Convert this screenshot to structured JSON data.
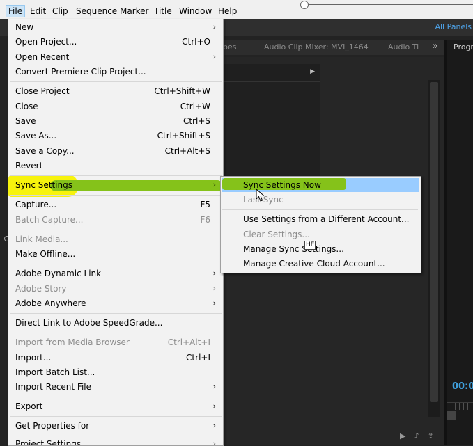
{
  "menubar": {
    "items": [
      "File",
      "Edit",
      "Clip",
      "Sequence",
      "Marker",
      "Title",
      "Window",
      "Help"
    ]
  },
  "background": {
    "all_panels": "All Panels",
    "tabs": [
      "pes",
      "Audio Clip Mixer: MVI_1464",
      "Audio Ti",
      "»"
    ],
    "program_tab": "Progr",
    "timecode": "00:0"
  },
  "file_menu": {
    "items": [
      {
        "label": "New",
        "shortcut": "",
        "submenu": true,
        "disabled": false
      },
      {
        "label": "Open Project...",
        "shortcut": "Ctrl+O",
        "submenu": false,
        "disabled": false
      },
      {
        "label": "Open Recent",
        "shortcut": "",
        "submenu": true,
        "disabled": false
      },
      {
        "label": "Convert Premiere Clip Project...",
        "shortcut": "",
        "submenu": false,
        "disabled": false
      },
      {
        "label": "Close Project",
        "shortcut": "Ctrl+Shift+W",
        "submenu": false,
        "disabled": false
      },
      {
        "label": "Close",
        "shortcut": "Ctrl+W",
        "submenu": false,
        "disabled": false
      },
      {
        "label": "Save",
        "shortcut": "Ctrl+S",
        "submenu": false,
        "disabled": false
      },
      {
        "label": "Save As...",
        "shortcut": "Ctrl+Shift+S",
        "submenu": false,
        "disabled": false
      },
      {
        "label": "Save a Copy...",
        "shortcut": "Ctrl+Alt+S",
        "submenu": false,
        "disabled": false
      },
      {
        "label": "Revert",
        "shortcut": "",
        "submenu": false,
        "disabled": false
      },
      {
        "label": "Sync Settings",
        "shortcut": "",
        "submenu": true,
        "disabled": false
      },
      {
        "label": "Capture...",
        "shortcut": "F5",
        "submenu": false,
        "disabled": false
      },
      {
        "label": "Batch Capture...",
        "shortcut": "F6",
        "submenu": false,
        "disabled": true
      },
      {
        "label": "Link Media...",
        "shortcut": "",
        "submenu": false,
        "disabled": true
      },
      {
        "label": "Make Offline...",
        "shortcut": "",
        "submenu": false,
        "disabled": false
      },
      {
        "label": "Adobe Dynamic Link",
        "shortcut": "",
        "submenu": true,
        "disabled": false
      },
      {
        "label": "Adobe Story",
        "shortcut": "",
        "submenu": true,
        "disabled": true
      },
      {
        "label": "Adobe Anywhere",
        "shortcut": "",
        "submenu": true,
        "disabled": false
      },
      {
        "label": "Direct Link to Adobe SpeedGrade...",
        "shortcut": "",
        "submenu": false,
        "disabled": false
      },
      {
        "label": "Import from Media Browser",
        "shortcut": "Ctrl+Alt+I",
        "submenu": false,
        "disabled": true
      },
      {
        "label": "Import...",
        "shortcut": "Ctrl+I",
        "submenu": false,
        "disabled": false
      },
      {
        "label": "Import Batch List...",
        "shortcut": "",
        "submenu": false,
        "disabled": false
      },
      {
        "label": "Import Recent File",
        "shortcut": "",
        "submenu": true,
        "disabled": false
      },
      {
        "label": "Export",
        "shortcut": "",
        "submenu": true,
        "disabled": false
      },
      {
        "label": "Get Properties for",
        "shortcut": "",
        "submenu": true,
        "disabled": false
      },
      {
        "label": "Project Settings",
        "shortcut": "",
        "submenu": true,
        "disabled": false
      }
    ]
  },
  "sync_submenu": {
    "items": [
      {
        "label": "Sync Settings Now",
        "disabled": false
      },
      {
        "label": "Last Sync",
        "disabled": true
      },
      {
        "label": "Use Settings from a Different Account...",
        "disabled": false
      },
      {
        "label": "Clear Settings...",
        "disabled": true
      },
      {
        "label": "Manage Sync Settings...",
        "disabled": false
      },
      {
        "label": "Manage Creative Cloud Account...",
        "disabled": false
      }
    ],
    "tooltip": "HE"
  },
  "colors": {
    "yellow_highlight": "#f7f200",
    "green_highlight": "#85c21a",
    "blue_hover": "#99ccff",
    "accent_blue": "#3f9fdb"
  }
}
